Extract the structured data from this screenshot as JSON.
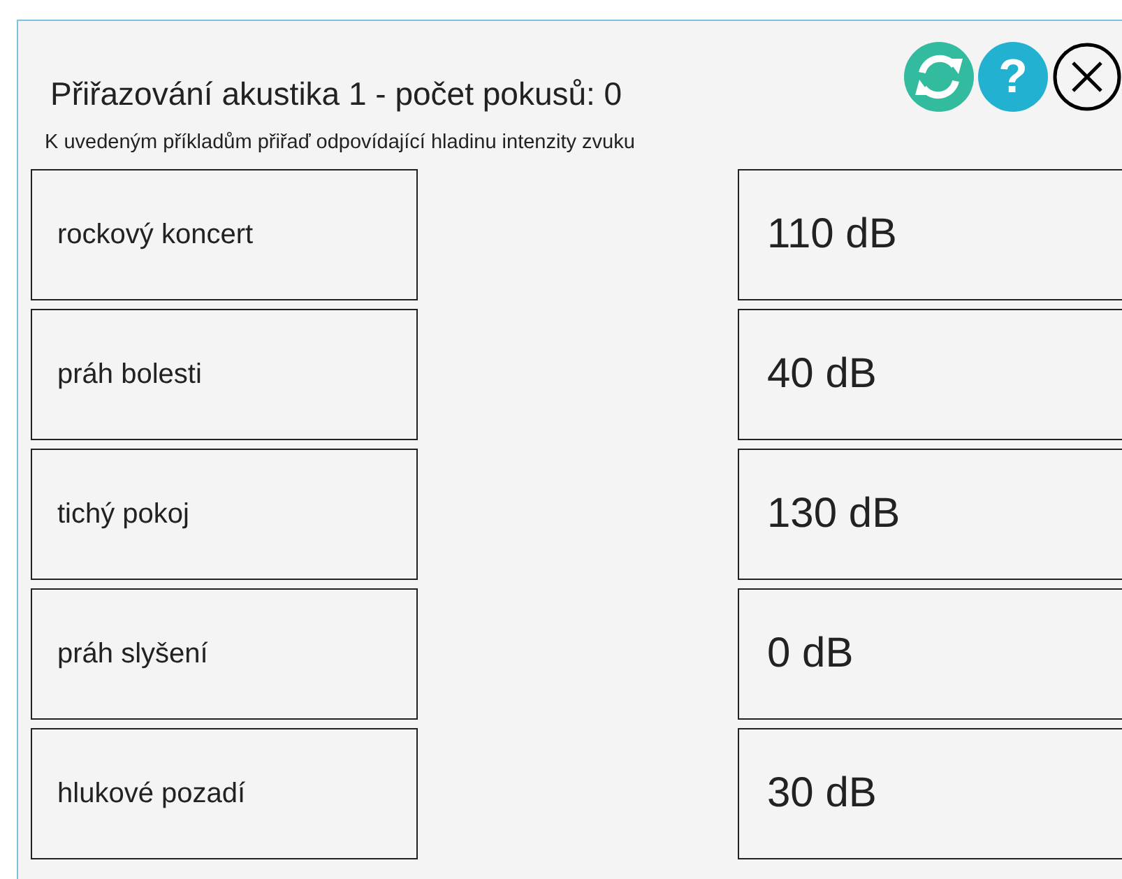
{
  "title": "Přiřazování akustika 1 - počet pokusů: 0",
  "help_symbol": "?",
  "instruction": "K uvedeným příkladům přiřaď odpovídající hladinu intenzity zvuku",
  "left_items": [
    "rockový koncert",
    "práh bolesti",
    "tichý pokoj",
    "práh slyšení",
    "hlukové pozadí"
  ],
  "right_items": [
    "110 dB",
    "40 dB",
    "130 dB",
    "0 dB",
    "30 dB"
  ]
}
